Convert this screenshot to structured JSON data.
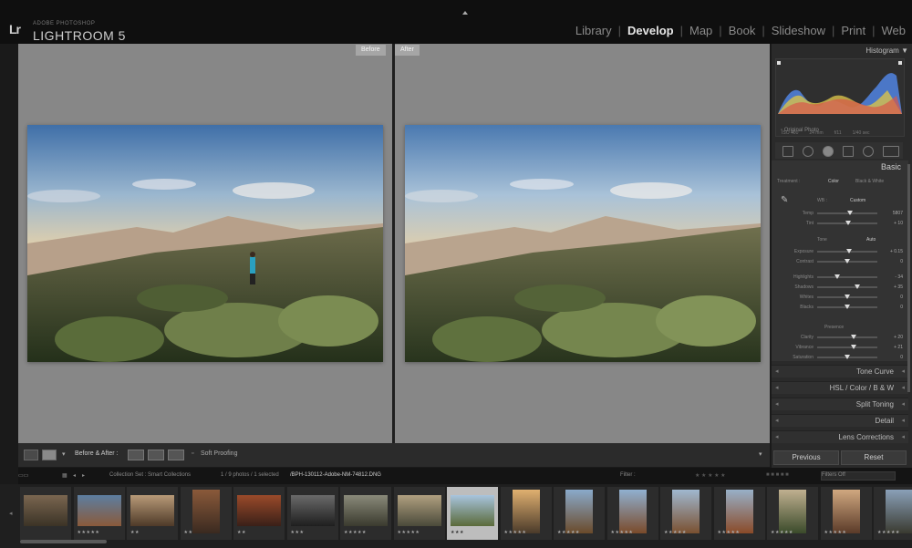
{
  "app": {
    "badge": "Lr",
    "vendor": "ADOBE PHOTOSHOP",
    "name": "LIGHTROOM 5"
  },
  "modules": [
    "Library",
    "Develop",
    "Map",
    "Book",
    "Slideshow",
    "Print",
    "Web"
  ],
  "active_module": "Develop",
  "workspace": {
    "before_label": "Before",
    "after_label": "After"
  },
  "toolbar": {
    "mode_label": "Before & After :",
    "soft_proofing": "Soft Proofing"
  },
  "right_panel": {
    "histogram_title": "Histogram",
    "histogram_info": [
      "ISO 400",
      "24 mm",
      "f/11",
      "1/40 sec"
    ],
    "original_photo": "Original Photo",
    "basic_title": "Basic",
    "treatment": [
      "Treatment :",
      "Color",
      "Black & White"
    ],
    "wb_label": "WB :",
    "wb_value": "Custom",
    "sliders_a": [
      {
        "label": "Temp",
        "value": "5807",
        "pos": 0.55
      },
      {
        "label": "Tint",
        "value": "+ 10",
        "pos": 0.52
      }
    ],
    "tone_label": "Tone",
    "tone_auto": "Auto",
    "sliders_b": [
      {
        "label": "Exposure",
        "value": "+ 0.15",
        "pos": 0.53
      },
      {
        "label": "Contrast",
        "value": "0",
        "pos": 0.5
      }
    ],
    "sliders_c": [
      {
        "label": "Highlights",
        "value": "- 34",
        "pos": 0.33
      },
      {
        "label": "Shadows",
        "value": "+ 35",
        "pos": 0.67
      },
      {
        "label": "Whites",
        "value": "0",
        "pos": 0.5
      },
      {
        "label": "Blacks",
        "value": "0",
        "pos": 0.5
      }
    ],
    "presence_label": "Presence",
    "sliders_d": [
      {
        "label": "Clarity",
        "value": "+ 20",
        "pos": 0.6
      },
      {
        "label": "Vibrance",
        "value": "+ 21",
        "pos": 0.6
      },
      {
        "label": "Saturation",
        "value": "0",
        "pos": 0.5
      }
    ],
    "panels": [
      {
        "title": "Tone Curve"
      },
      {
        "title": "HSL / Color / B & W"
      },
      {
        "title": "Split Toning"
      },
      {
        "title": "Detail"
      },
      {
        "title": "Lens Corrections"
      }
    ],
    "previous_button": "Previous",
    "reset_button": "Reset"
  },
  "filmstrip_bar": {
    "collection": "Collection Set : Smart Collections",
    "count": "1 / 9 photos / 1 selected",
    "filename": "/BPH-130112-Adobe-NM-74812.DNG",
    "filter_label": "Filter :",
    "filter_value": "Filters Off"
  },
  "thumbnails": [
    {
      "stars": "",
      "c1": "#7a6650",
      "c2": "#3b3326",
      "portrait": false
    },
    {
      "stars": "★★★★★",
      "c1": "#5c7ea0",
      "c2": "#8a5a3a",
      "portrait": false
    },
    {
      "stars": "★★",
      "c1": "#b89a78",
      "c2": "#4e3a28",
      "portrait": false
    },
    {
      "stars": "★★",
      "c1": "#8a5a3a",
      "c2": "#3a2a20",
      "portrait": true
    },
    {
      "stars": "★★",
      "c1": "#9a4a2a",
      "c2": "#3a2018",
      "portrait": false
    },
    {
      "stars": "★★★",
      "c1": "#6a6a6a",
      "c2": "#1e1e1e",
      "portrait": false
    },
    {
      "stars": "★★★★★",
      "c1": "#8a8a7a",
      "c2": "#3a3a2e",
      "portrait": false
    },
    {
      "stars": "★★★★★",
      "c1": "#b0a080",
      "c2": "#4a4a3a",
      "portrait": false
    },
    {
      "stars": "★★★",
      "c1": "#a8c4de",
      "c2": "#5a6a3a",
      "portrait": false
    },
    {
      "stars": "★★★★★",
      "c1": "#e0b070",
      "c2": "#4a3a2a",
      "portrait": true
    },
    {
      "stars": "★★★★★",
      "c1": "#8aaacb",
      "c2": "#6a4a2a",
      "portrait": true
    },
    {
      "stars": "★★★★★",
      "c1": "#90b0d0",
      "c2": "#7a4a2a",
      "portrait": true
    },
    {
      "stars": "★★★★★",
      "c1": "#a0b8d0",
      "c2": "#7a5030",
      "portrait": true
    },
    {
      "stars": "★★★★★",
      "c1": "#98b0c8",
      "c2": "#8a4a28",
      "portrait": true
    },
    {
      "stars": "★★★★★",
      "c1": "#c0b090",
      "c2": "#3a4a2a",
      "portrait": true
    },
    {
      "stars": "★★★★★",
      "c1": "#d0a880",
      "c2": "#5a3a28",
      "portrait": true
    },
    {
      "stars": "★★★★★",
      "c1": "#8aa0b8",
      "c2": "#3a3a30",
      "portrait": true
    }
  ]
}
